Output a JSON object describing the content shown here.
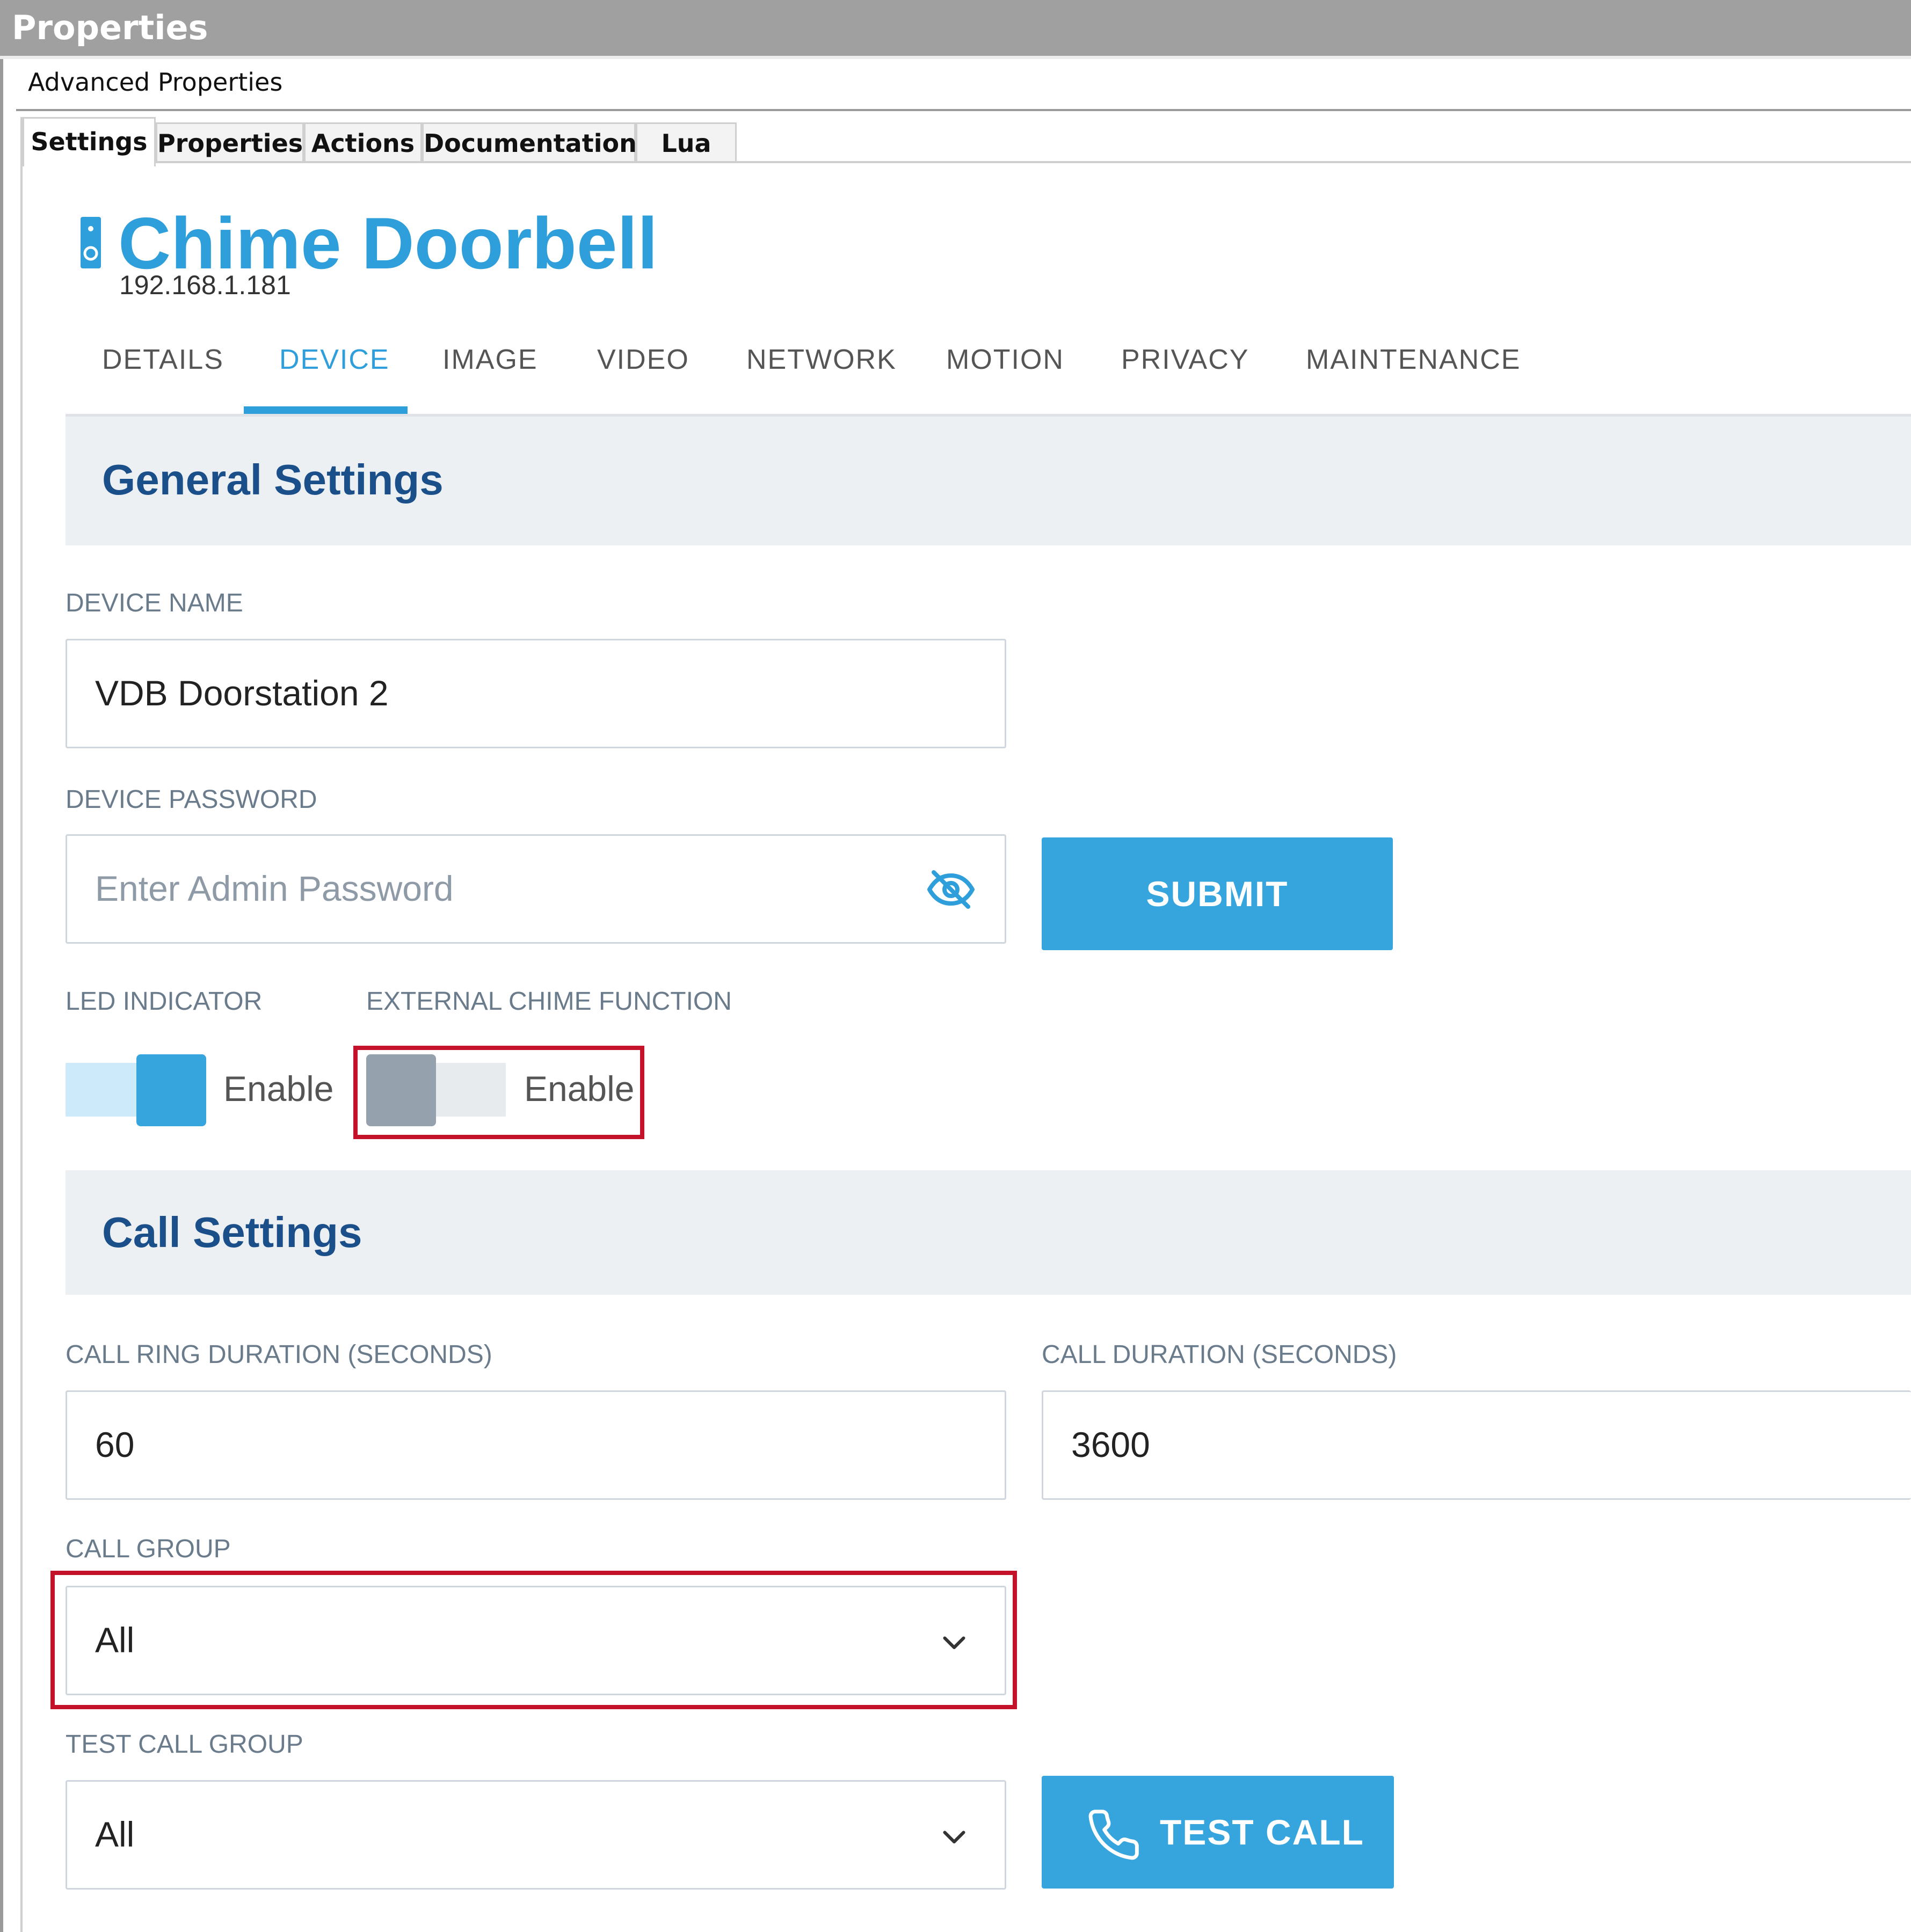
{
  "window": {
    "title": "Properties",
    "subtitle": "Advanced Properties",
    "tabs": [
      {
        "label": "Settings",
        "active": true
      },
      {
        "label": "Properties",
        "active": false
      },
      {
        "label": "Actions",
        "active": false
      },
      {
        "label": "Documentation",
        "active": false
      },
      {
        "label": "Lua",
        "active": false
      }
    ]
  },
  "device": {
    "icon": "doorbell-icon",
    "title": "Chime Doorbell",
    "ip": "192.168.1.181"
  },
  "nav": {
    "items": [
      "DETAILS",
      "DEVICE",
      "IMAGE",
      "VIDEO",
      "NETWORK",
      "MOTION",
      "PRIVACY",
      "MAINTENANCE"
    ],
    "active": "DEVICE"
  },
  "general": {
    "title": "General Settings",
    "device_name": {
      "label": "DEVICE NAME",
      "value": "VDB Doorstation 2"
    },
    "device_password": {
      "label": "DEVICE PASSWORD",
      "placeholder": "Enter Admin Password",
      "icon": "eye-off-icon"
    },
    "submit_label": "SUBMIT",
    "led": {
      "label": "LED INDICATOR",
      "toggle_label": "Enable",
      "enabled": true
    },
    "chime": {
      "label": "EXTERNAL CHIME FUNCTION",
      "toggle_label": "Enable",
      "enabled": false
    }
  },
  "call": {
    "title": "Call Settings",
    "ring_duration": {
      "label": "CALL RING DURATION (SECONDS)",
      "value": "60"
    },
    "call_duration": {
      "label": "CALL DURATION (SECONDS)",
      "value": "3600"
    },
    "call_group": {
      "label": "CALL GROUP",
      "value": "All",
      "icon": "chevron-down-icon"
    },
    "test_call_group": {
      "label": "TEST CALL GROUP",
      "value": "All",
      "icon": "chevron-down-icon"
    },
    "test_call_button": {
      "label": "TEST CALL",
      "icon": "phone-icon"
    }
  },
  "colors": {
    "accent": "#36a5dd",
    "heading": "#1a4f8a",
    "highlight": "#c3122a",
    "section_bg": "#edf0f3"
  }
}
